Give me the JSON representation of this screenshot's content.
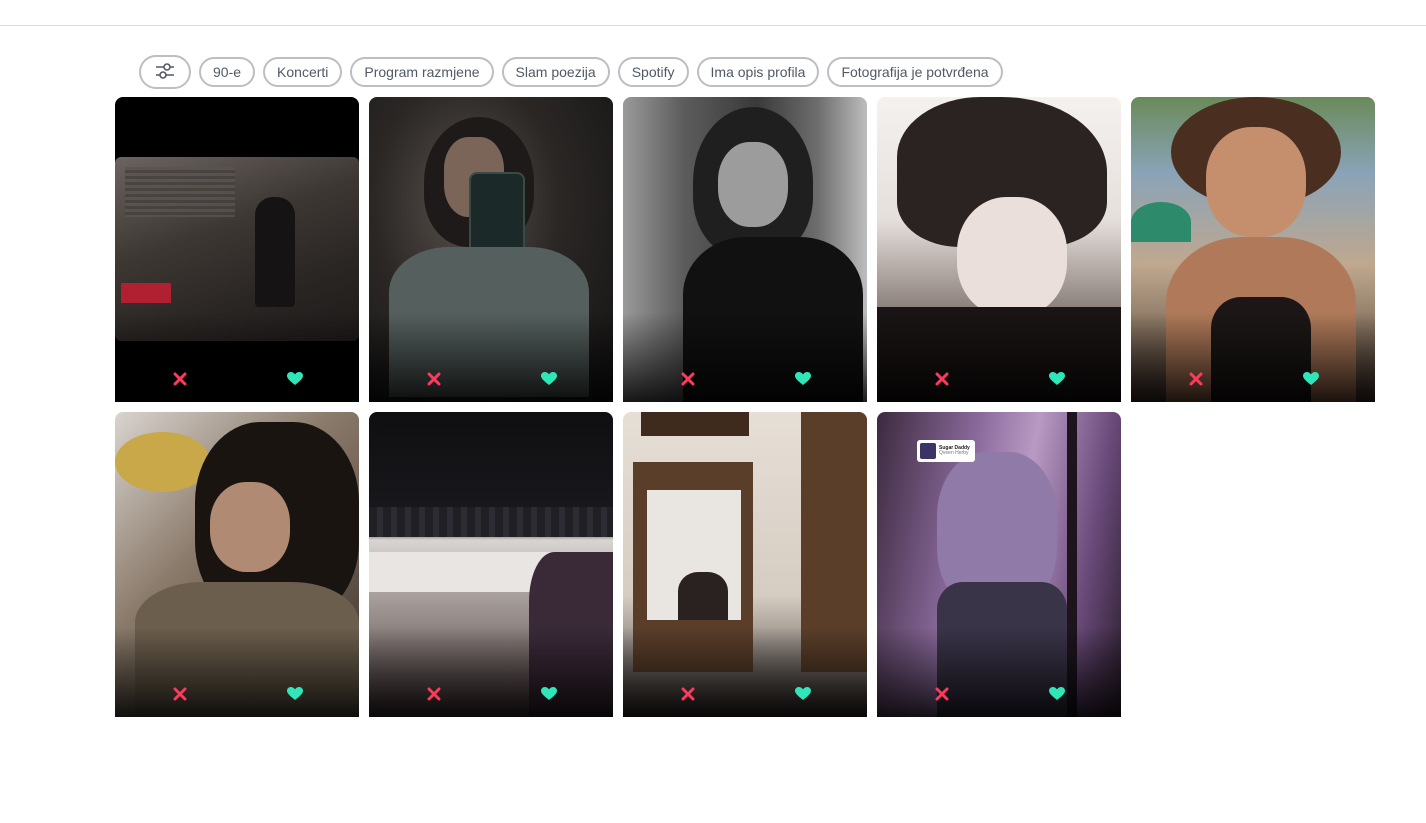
{
  "filters": {
    "filter_icon": "sliders-icon",
    "chips": [
      "90-e",
      "Koncerti",
      "Program razmjene",
      "Slam poezija",
      "Spotify",
      "Ima opis profila",
      "Fotografija je potvrđena"
    ]
  },
  "colors": {
    "nope": "#fd3a5c",
    "like": "#2ee6b8",
    "chip_border": "#bdbec4",
    "chip_text": "#505965"
  },
  "cards": [
    {
      "scene": "window-sitting",
      "nope_icon": "close-icon",
      "like_icon": "heart-icon"
    },
    {
      "scene": "mirror-selfie-dark",
      "nope_icon": "close-icon",
      "like_icon": "heart-icon"
    },
    {
      "scene": "grayscale-portrait",
      "nope_icon": "close-icon",
      "like_icon": "heart-icon"
    },
    {
      "scene": "bright-closeup",
      "nope_icon": "close-icon",
      "like_icon": "heart-icon"
    },
    {
      "scene": "beach-selfie",
      "nope_icon": "close-icon",
      "like_icon": "heart-icon"
    },
    {
      "scene": "drink-selfie",
      "nope_icon": "close-icon",
      "like_icon": "heart-icon"
    },
    {
      "scene": "fabric-closeup",
      "nope_icon": "close-icon",
      "like_icon": "heart-icon"
    },
    {
      "scene": "wall-mirror",
      "nope_icon": "close-icon",
      "like_icon": "heart-icon"
    },
    {
      "scene": "purple-light",
      "nope_icon": "close-icon",
      "like_icon": "heart-icon",
      "spotify_badge": {
        "title": "Sugar Daddy",
        "artist": "Qveen Herby"
      }
    }
  ]
}
